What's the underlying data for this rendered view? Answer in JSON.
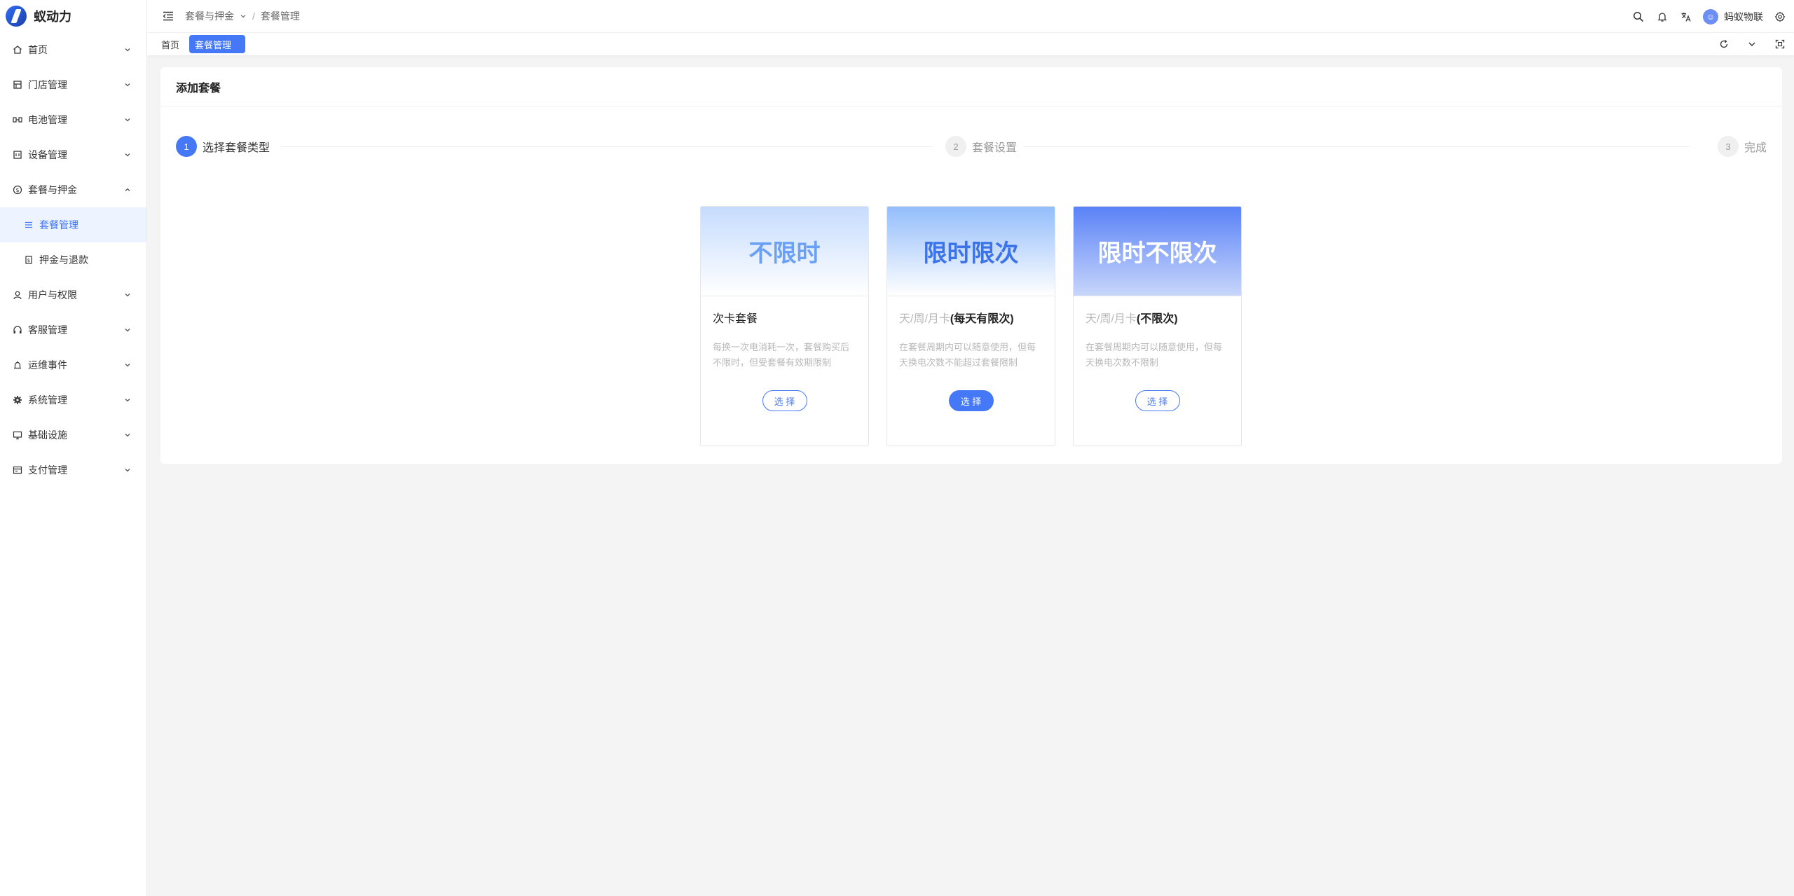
{
  "app": {
    "name": "蚁动力"
  },
  "sidebar": {
    "items": [
      {
        "label": "首页",
        "icon": "home-icon"
      },
      {
        "label": "门店管理",
        "icon": "store-icon"
      },
      {
        "label": "电池管理",
        "icon": "battery-icon"
      },
      {
        "label": "设备管理",
        "icon": "device-icon"
      },
      {
        "label": "套餐与押金",
        "icon": "dollar-icon",
        "expanded": true
      },
      {
        "label": "用户与权限",
        "icon": "user-icon"
      },
      {
        "label": "客服管理",
        "icon": "headset-icon"
      },
      {
        "label": "运维事件",
        "icon": "alarm-icon"
      },
      {
        "label": "系统管理",
        "icon": "gear-icon"
      },
      {
        "label": "基础设施",
        "icon": "monitor-icon"
      },
      {
        "label": "支付管理",
        "icon": "payment-icon"
      }
    ],
    "subitems": [
      {
        "label": "套餐管理",
        "icon": "list-icon",
        "active": true
      },
      {
        "label": "押金与退款",
        "icon": "refund-icon",
        "active": false
      }
    ]
  },
  "header": {
    "breadcrumb": [
      "套餐与押金",
      "套餐管理"
    ],
    "user_name": "蚂蚁物联"
  },
  "tabs": [
    {
      "label": "首页",
      "active": false
    },
    {
      "label": "套餐管理",
      "active": true
    }
  ],
  "card": {
    "title": "添加套餐",
    "steps": [
      {
        "number": "1",
        "title": "选择套餐类型",
        "active": true
      },
      {
        "number": "2",
        "title": "套餐设置",
        "active": false
      },
      {
        "number": "3",
        "title": "完成",
        "active": false
      }
    ],
    "plans": [
      {
        "banner": "不限时",
        "title_prefix": "",
        "title_main": "次卡套餐",
        "desc": "每换一次电消耗一次，套餐购买后不限时，但受套餐有效期限制",
        "button": "选 择"
      },
      {
        "banner": "限时限次",
        "title_prefix": "天/周/月卡",
        "title_main": "(每天有限次)",
        "desc": "在套餐周期内可以随意使用，但每天换电次数不能超过套餐限制",
        "button": "选 择"
      },
      {
        "banner": "限时不限次",
        "title_prefix": "天/周/月卡",
        "title_main": "(不限次)",
        "desc": "在套餐周期内可以随意使用，但每天换电次数不限制",
        "button": "选 择"
      }
    ]
  },
  "colors": {
    "accent": "#4578f7",
    "active_bg": "#eef4ff"
  }
}
